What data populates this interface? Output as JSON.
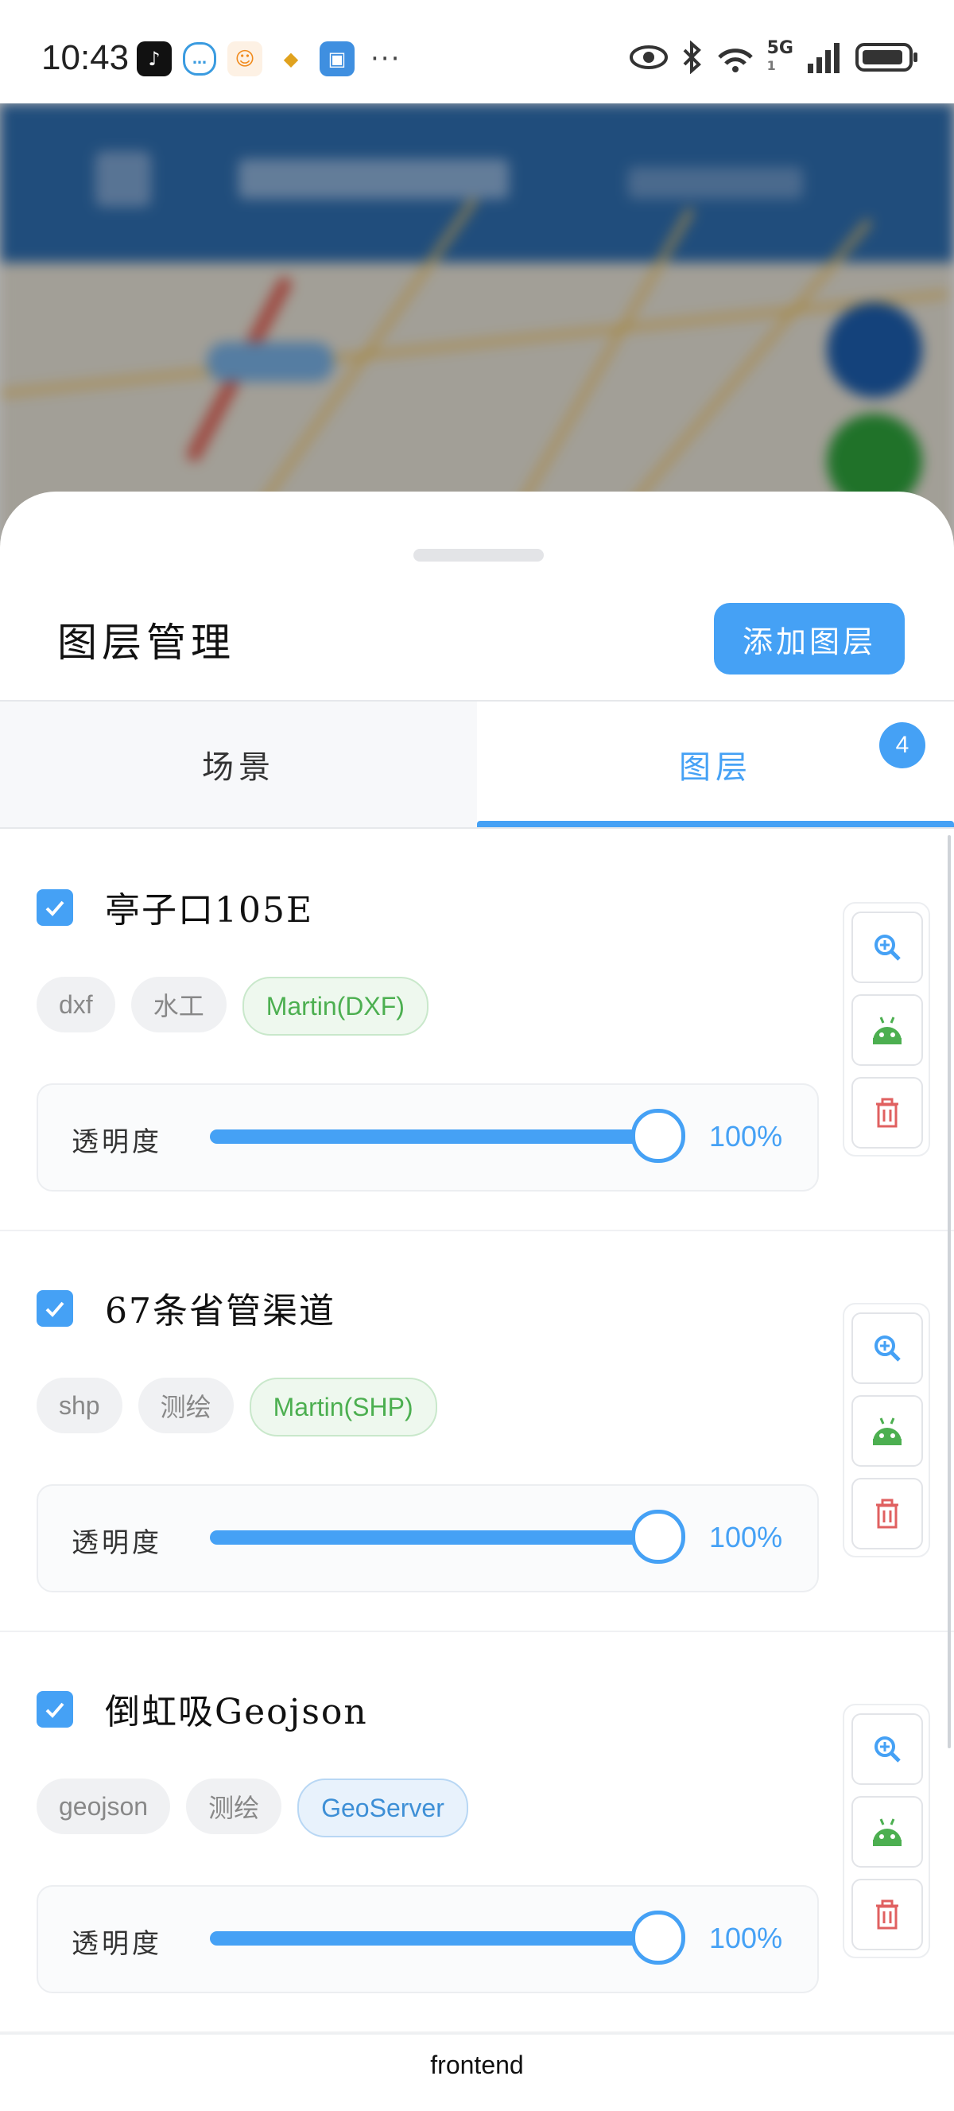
{
  "status_bar": {
    "time": "10:43",
    "network": "5G",
    "sim": "1",
    "icons": [
      "tiktok-icon",
      "chat-icon",
      "app-icon",
      "honor-icon",
      "id-card-icon",
      "eye-icon",
      "bluetooth-icon",
      "wifi-icon",
      "signal-icon",
      "battery-icon"
    ]
  },
  "sheet": {
    "title": "图层管理",
    "add_button": "添加图层"
  },
  "tabs": [
    {
      "label": "场景"
    },
    {
      "label": "图层",
      "badge": "4",
      "active": true
    }
  ],
  "opacity_label": "透明度",
  "layers": [
    {
      "name": "亭子口105E",
      "checked": true,
      "tags": [
        "dxf",
        "水工",
        "Martin(DXF)"
      ],
      "opacity": "100%",
      "opacity_fraction": 1.0
    },
    {
      "name": "67条省管渠道",
      "checked": true,
      "tags": [
        "shp",
        "测绘",
        "Martin(SHP)"
      ],
      "opacity": "100%",
      "opacity_fraction": 1.0
    },
    {
      "name": "倒虹吸Geojson",
      "checked": true,
      "tags": [
        "geojson",
        "测绘",
        "GeoServer"
      ],
      "opacity": "100%",
      "opacity_fraction": 1.0
    }
  ],
  "footer": "frontend",
  "colors": {
    "accent": "#45a1f5",
    "green": "#4caf50",
    "danger": "#e06060"
  }
}
